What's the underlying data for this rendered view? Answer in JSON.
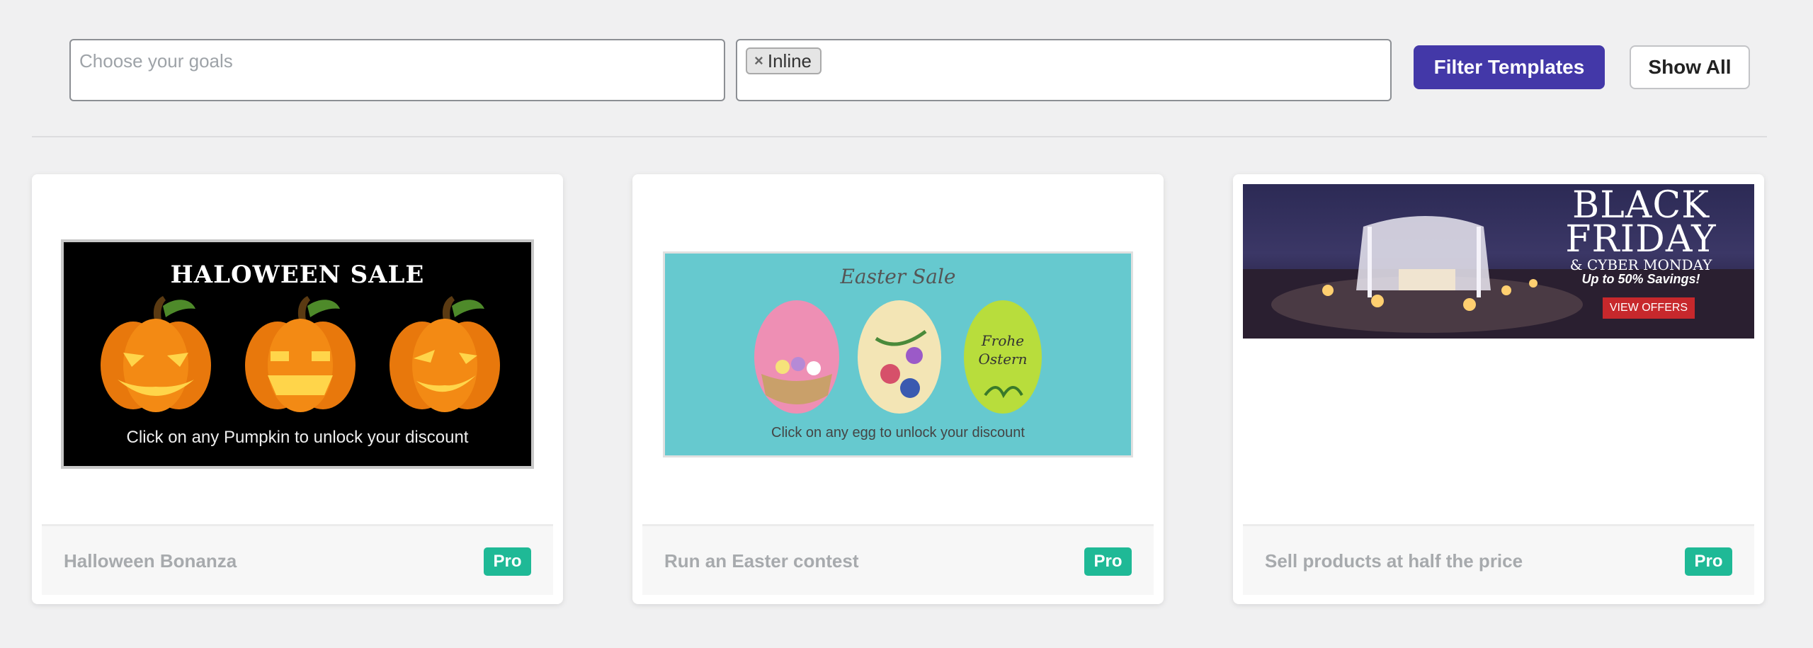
{
  "filters": {
    "goals_placeholder": "Choose your goals",
    "type_chip": "Inline",
    "chip_remove": "×",
    "filter_button": "Filter Templates",
    "show_all_button": "Show All"
  },
  "templates": [
    {
      "title": "Halloween Bonanza",
      "badge": "Pro",
      "banner_title": "HALOWEEN SALE",
      "banner_subtitle": "Click on any Pumpkin to unlock your discount"
    },
    {
      "title": "Run an Easter contest",
      "badge": "Pro",
      "banner_title": "Easter Sale",
      "banner_subtitle": "Click on any egg to unlock your discount",
      "egg_text_1": "Frohe",
      "egg_text_2": "Ostern"
    },
    {
      "title": "Sell products at half the price",
      "badge": "Pro",
      "banner_line_1": "BLACK",
      "banner_line_2": "FRIDAY",
      "banner_line_3": "& CYBER MONDAY",
      "banner_line_4": "Up to 50% Savings!",
      "banner_button": "VIEW OFFERS"
    }
  ],
  "colors": {
    "primary": "#4338a8",
    "pro_badge": "#1fb996",
    "offers_button": "#c7282c"
  }
}
